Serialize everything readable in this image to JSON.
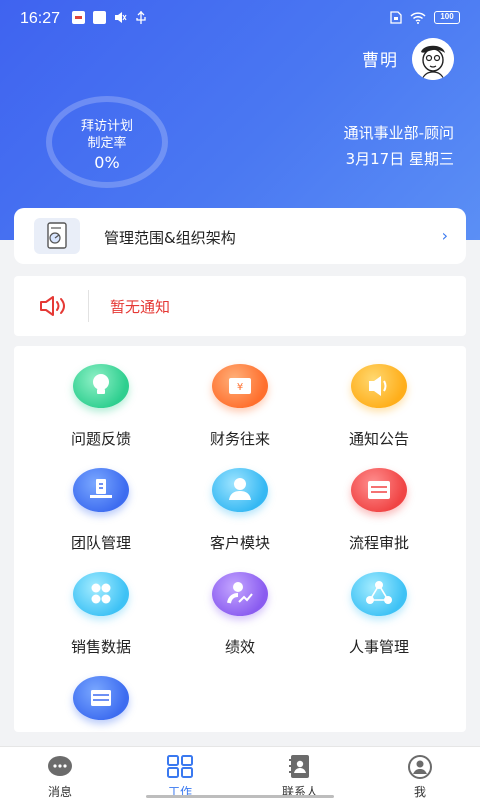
{
  "status_bar": {
    "time": "16:27",
    "battery": "100"
  },
  "header": {
    "user_name": "曹明",
    "plan_ring": {
      "label_line1": "拜访计划",
      "label_line2": "制定率",
      "value": "0%"
    },
    "department": "通讯事业部-顾问",
    "date": "3月17日 星期三"
  },
  "org_card": {
    "label": "管理范围&组织架构",
    "arrow": "›"
  },
  "notice": {
    "text": "暂无通知"
  },
  "grid": {
    "items": [
      {
        "label": "问题反馈",
        "icon": "lightbulb-icon",
        "color": "#2ecf8f"
      },
      {
        "label": "财务往来",
        "icon": "money-icon",
        "color": "#ff6f2d"
      },
      {
        "label": "通知公告",
        "icon": "speaker-icon",
        "color": "#ffae1a"
      },
      {
        "label": "团队管理",
        "icon": "team-icon",
        "color": "#3d6cf0"
      },
      {
        "label": "客户模块",
        "icon": "customer-icon",
        "color": "#35b8f3"
      },
      {
        "label": "流程审批",
        "icon": "approval-icon",
        "color": "#f04444"
      },
      {
        "label": "销售数据",
        "icon": "sales-data-icon",
        "color": "#3ec2f5"
      },
      {
        "label": "绩效",
        "icon": "performance-icon",
        "color": "#8a5cf0"
      },
      {
        "label": "人事管理",
        "icon": "hr-icon",
        "color": "#3ec2f5"
      },
      {
        "label": "",
        "icon": "list-icon",
        "color": "#3d6cf0"
      }
    ]
  },
  "tabbar": {
    "tabs": [
      {
        "label": "消息",
        "icon": "message-icon"
      },
      {
        "label": "工作",
        "icon": "work-grid-icon",
        "active": true
      },
      {
        "label": "联系人",
        "icon": "contacts-icon"
      },
      {
        "label": "我",
        "icon": "profile-icon"
      }
    ]
  },
  "colors": {
    "header_gradient_start": "#3f63f0",
    "header_gradient_end": "#5b8ff5",
    "accent": "#3a79f0",
    "notice_red": "#e53935"
  }
}
